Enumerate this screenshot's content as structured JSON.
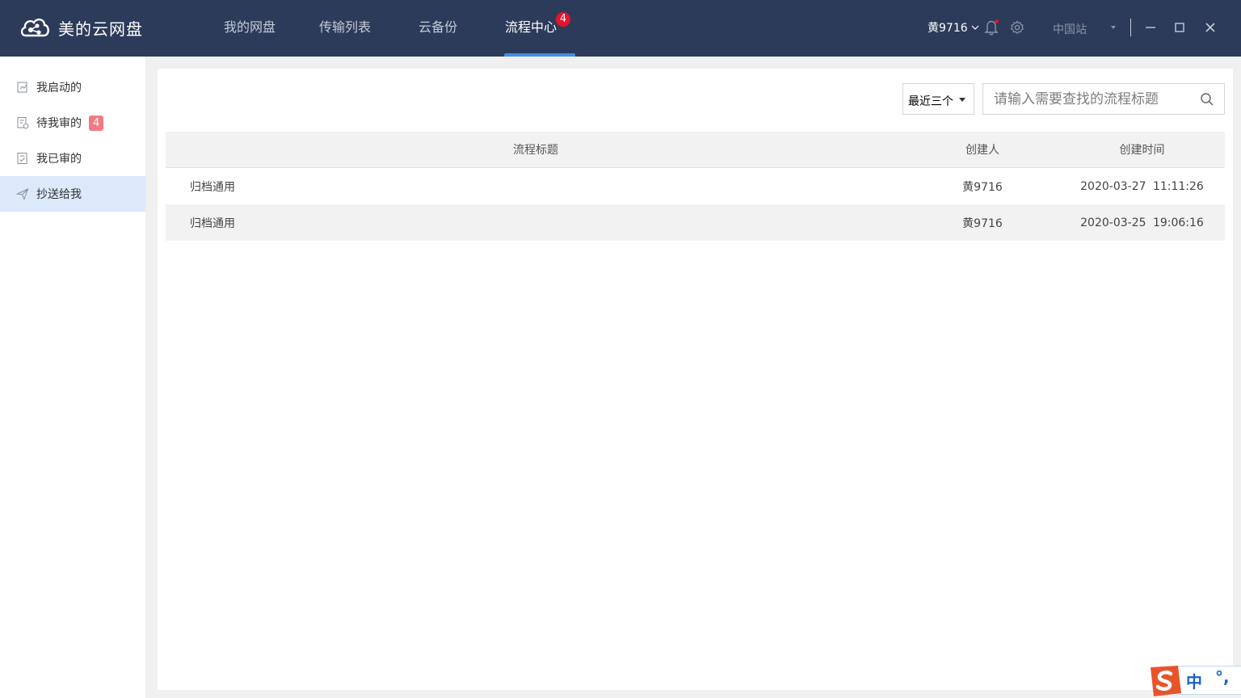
{
  "app": {
    "title": "美的云网盘"
  },
  "nav": {
    "tabs": [
      {
        "label": "我的网盘"
      },
      {
        "label": "传输列表"
      },
      {
        "label": "云备份"
      },
      {
        "label": "流程中心",
        "badge": "4",
        "active": true
      }
    ]
  },
  "header": {
    "user": "黄9716",
    "region": "中国站",
    "icons": [
      "bell-icon",
      "gear-icon",
      "minimize-icon",
      "maximize-icon",
      "close-icon"
    ]
  },
  "sidebar": {
    "items": [
      {
        "label": "我启动的",
        "icon": "edit-doc-icon"
      },
      {
        "label": "待我审的",
        "icon": "pending-doc-icon",
        "badge": "4"
      },
      {
        "label": "我已审的",
        "icon": "done-doc-icon"
      },
      {
        "label": "抄送给我",
        "icon": "send-icon",
        "active": true
      }
    ]
  },
  "toolbar": {
    "filter": "最近三个",
    "search_placeholder": "请输入需要查找的流程标题"
  },
  "table": {
    "columns": [
      "流程标题",
      "创建人",
      "创建时间"
    ],
    "rows": [
      {
        "title": "归档通用",
        "creator": "黄9716",
        "time": "2020-03-27  11:11:26"
      },
      {
        "title": "归档通用",
        "creator": "黄9716",
        "time": "2020-03-25  19:06:16"
      }
    ]
  },
  "ime": {
    "mode": "中",
    "punct": "°,"
  },
  "colors": {
    "topbar": "#2c3b5a",
    "accent": "#3f8fe6",
    "badge_red": "#e8122d",
    "sidebar_badge": "#ef7b82",
    "active_sidebar": "#dbe9fb"
  }
}
